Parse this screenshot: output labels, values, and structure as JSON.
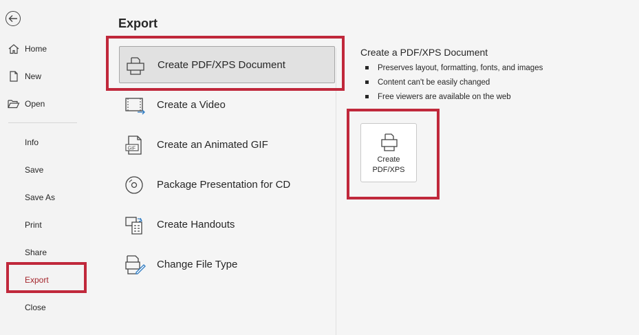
{
  "nav": {
    "items": [
      {
        "label": "Home"
      },
      {
        "label": "New"
      },
      {
        "label": "Open"
      },
      {
        "label": "Info"
      },
      {
        "label": "Save"
      },
      {
        "label": "Save As"
      },
      {
        "label": "Print"
      },
      {
        "label": "Share"
      },
      {
        "label": "Export"
      },
      {
        "label": "Close"
      }
    ],
    "active": "Export"
  },
  "main": {
    "title": "Export",
    "options": [
      {
        "label": "Create PDF/XPS Document",
        "icon": "pdf-document-icon",
        "selected": true
      },
      {
        "label": "Create a Video",
        "icon": "video-icon"
      },
      {
        "label": "Create an Animated GIF",
        "icon": "gif-icon"
      },
      {
        "label": "Package Presentation for CD",
        "icon": "cd-icon"
      },
      {
        "label": "Create Handouts",
        "icon": "handouts-icon"
      },
      {
        "label": "Change File Type",
        "icon": "change-file-type-icon"
      }
    ]
  },
  "detail": {
    "title": "Create a PDF/XPS Document",
    "bullets": [
      "Preserves layout, formatting, fonts, and images",
      "Content can't be easily changed",
      "Free viewers are available on the web"
    ],
    "button_line1": "Create",
    "button_line2": "PDF/XPS"
  },
  "colors": {
    "highlight": "#c0283b",
    "active_nav": "#a4262c"
  }
}
